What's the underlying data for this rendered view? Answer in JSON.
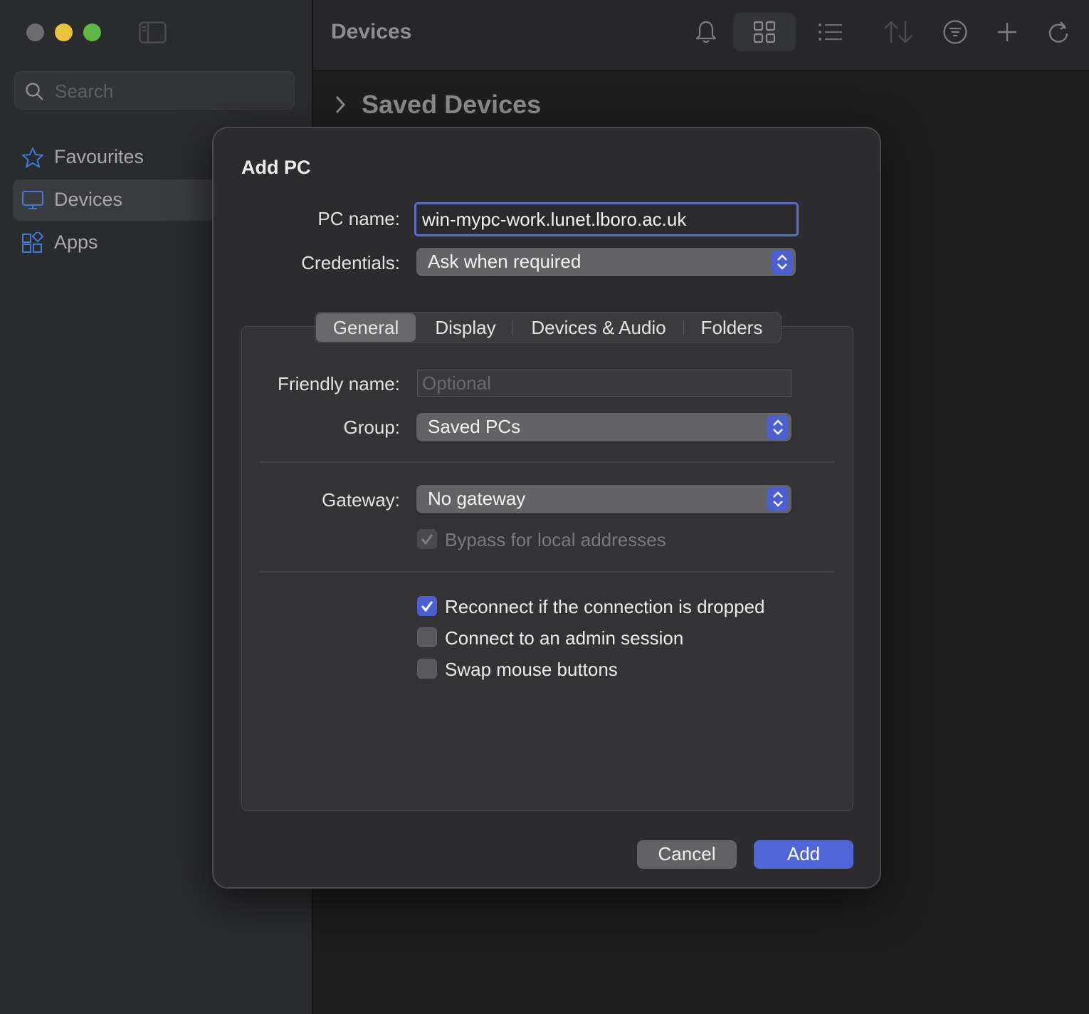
{
  "sidebar": {
    "search_placeholder": "Search",
    "items": [
      {
        "label": "Favourites",
        "icon": "star-icon"
      },
      {
        "label": "Devices",
        "icon": "monitor-icon"
      },
      {
        "label": "Apps",
        "icon": "apps-icon"
      }
    ]
  },
  "main": {
    "title": "Devices",
    "section_title": "Saved Devices"
  },
  "dialog": {
    "title": "Add PC",
    "pc_name_label": "PC name:",
    "pc_name_value": "win-mypc-work.lunet.lboro.ac.uk",
    "credentials_label": "Credentials:",
    "credentials_value": "Ask when required",
    "tabs": [
      "General",
      "Display",
      "Devices & Audio",
      "Folders"
    ],
    "friendly_name_label": "Friendly name:",
    "friendly_name_placeholder": "Optional",
    "group_label": "Group:",
    "group_value": "Saved PCs",
    "gateway_label": "Gateway:",
    "gateway_value": "No gateway",
    "bypass_label": "Bypass for local addresses",
    "reconnect_label": "Reconnect if the connection is dropped",
    "admin_label": "Connect to an admin session",
    "swap_label": "Swap mouse buttons",
    "cancel_label": "Cancel",
    "add_label": "Add"
  },
  "colors": {
    "accent": "#4f66d9",
    "background": "#1e1e1e",
    "sidebar": "#2a2b2d",
    "dialog": "#2c2c2e"
  }
}
